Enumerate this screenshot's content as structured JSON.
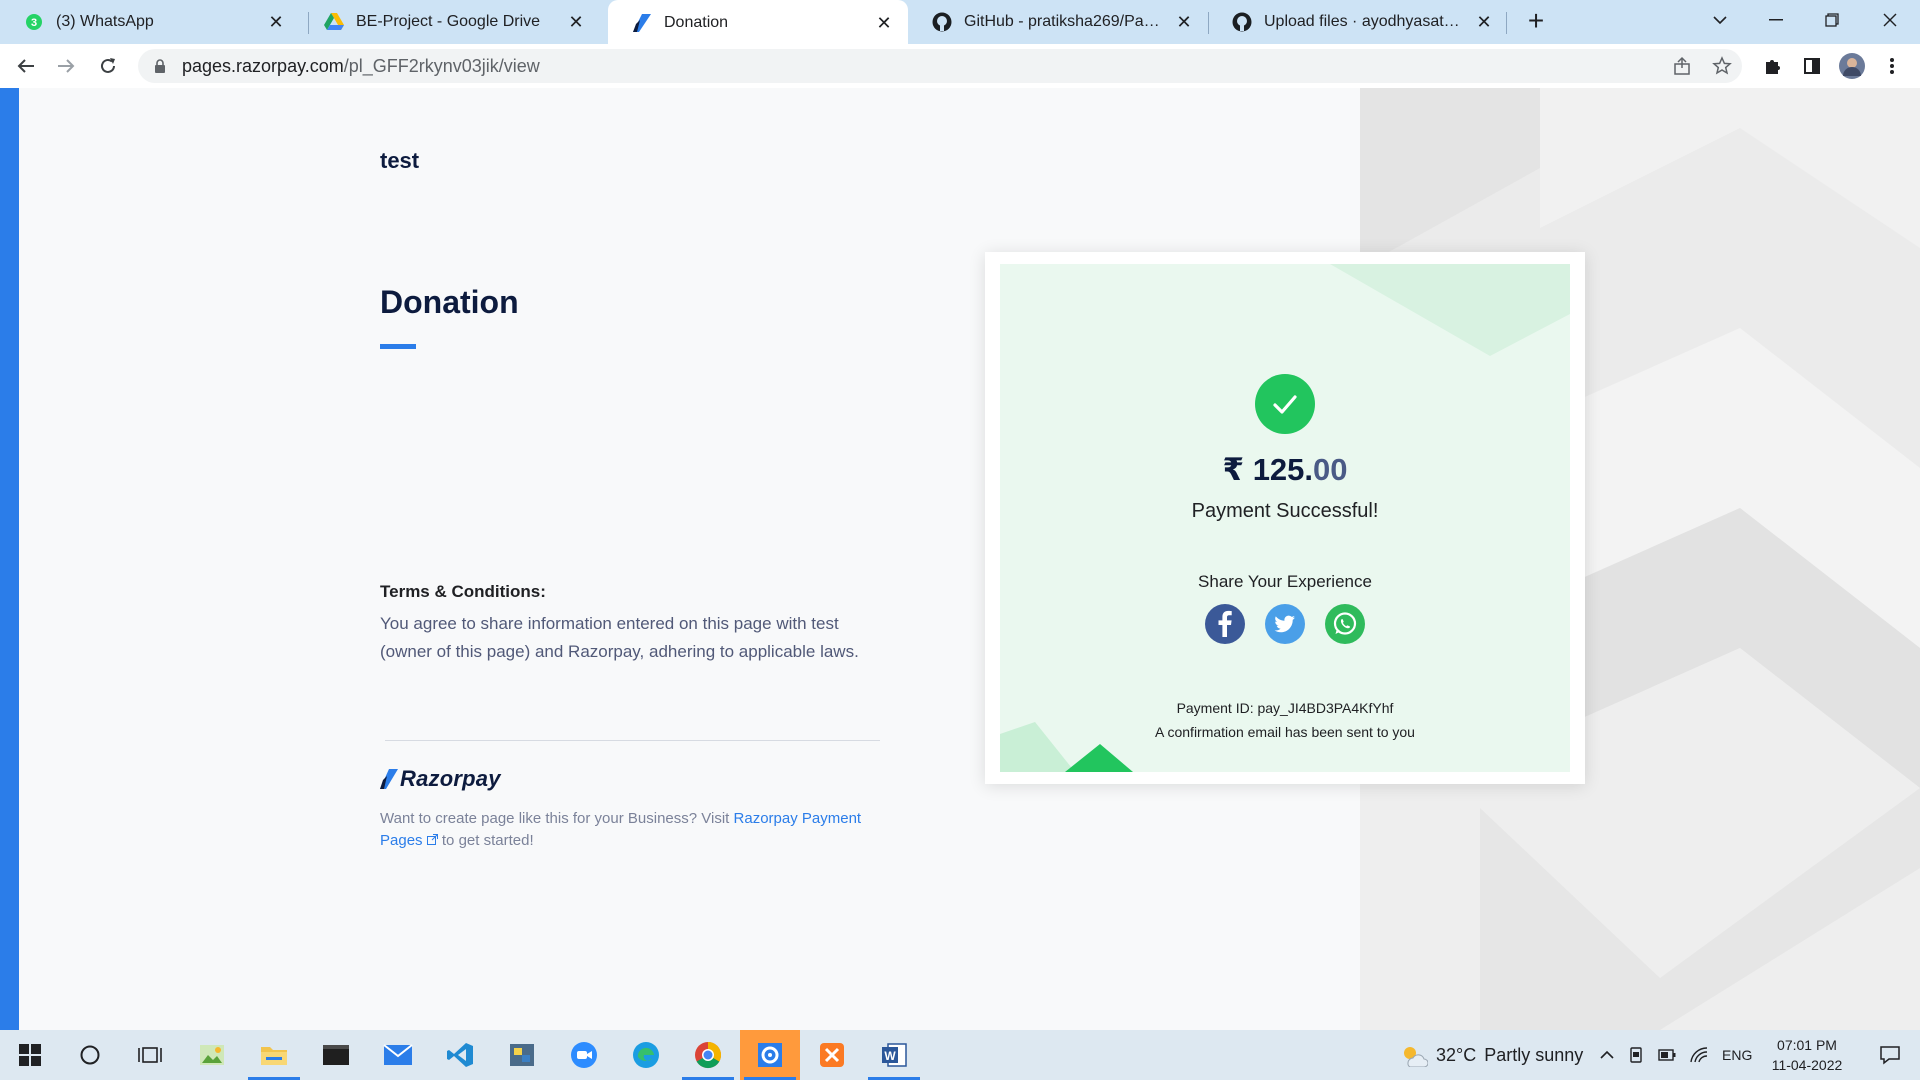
{
  "browser": {
    "tabs": [
      {
        "title": "(3) WhatsApp",
        "favicon": "whatsapp-icon",
        "badge": "3"
      },
      {
        "title": "BE-Project - Google Drive",
        "favicon": "google-drive-icon"
      },
      {
        "title": "Donation",
        "favicon": "razorpay-icon",
        "active": true
      },
      {
        "title": "GitHub - pratiksha269/Payment-I",
        "favicon": "github-icon"
      },
      {
        "title": "Upload files · ayodhyasathe16/Pa",
        "favicon": "github-icon"
      }
    ],
    "new_tab_label": "+",
    "url_host": "pages.razorpay.com",
    "url_path": "/pl_GFF2rkynv03jik/view",
    "colors": {
      "tabstrip": "#cde3f5",
      "accent": "#2b7de9"
    }
  },
  "page": {
    "merchant_name": "test",
    "title": "Donation",
    "terms_heading": "Terms & Conditions:",
    "terms_text": "You agree to share information entered on this page with test (owner of this page) and Razorpay, adhering to applicable laws.",
    "brand_name": "Razorpay",
    "promo_prefix": "Want to create page like this for your Business? Visit ",
    "promo_link": "Razorpay Payment Pages",
    "promo_suffix": " to get started!"
  },
  "receipt": {
    "currency_symbol": "₹",
    "amount_whole": "125.",
    "amount_decimals": "00",
    "status": "Payment Successful!",
    "share_label": "Share Your Experience",
    "share_targets": [
      "facebook-icon",
      "twitter-icon",
      "whatsapp-icon"
    ],
    "payment_id": "Payment ID: pay_JI4BD3PA4KfYhf",
    "confirmation": "A confirmation email has been sent to you",
    "colors": {
      "success": "#22c55e",
      "card_bg": "#eaf8ef"
    }
  },
  "taskbar": {
    "weather_temp": "32°C",
    "weather_text": "Partly sunny",
    "language": "ENG",
    "time": "07:01 PM",
    "date": "11-04-2022"
  }
}
